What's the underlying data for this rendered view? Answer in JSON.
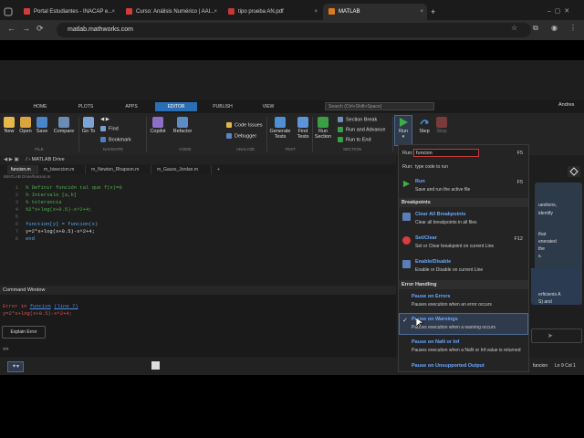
{
  "browser": {
    "tabs": [
      {
        "label": "Portal Estudiantes - INACAP e...",
        "color": "#d43c3c"
      },
      {
        "label": "Curso: Análisis Numérico | AAI...",
        "color": "#d43c3c"
      },
      {
        "label": "tipo prueba AN.pdf",
        "color": "#c93636"
      },
      {
        "label": "MATLAB",
        "color": "#e07a1f"
      }
    ],
    "new_tab": "+",
    "url": "matlab.mathworks.com"
  },
  "matlab": {
    "ribbon_tabs": [
      "HOME",
      "PLOTS",
      "APPS",
      "EDITOR",
      "PUBLISH",
      "VIEW"
    ],
    "active_ribbon_tab": "EDITOR",
    "search_placeholder": "Search (Ctrl+Shift+Space)",
    "user": "Andres",
    "toolstrip": {
      "new": "New",
      "open": "Open",
      "save": "Save",
      "compare": "Compare",
      "file_group": "FILE",
      "goto": "Go To",
      "find": "Find",
      "bookmark": "Bookmark",
      "navigate_group": "NAVIGATE",
      "copilot": "Copilot",
      "refactor": "Refactor",
      "code_issues": "Code Issues",
      "debugger": "Debugger",
      "code_group": "CODE",
      "analyze_group": "ANALYZE",
      "generate_tests": [
        "Generate",
        "Tests"
      ],
      "find_tests": [
        "Find",
        "Tests"
      ],
      "test_group": "TEST",
      "section_break": "Section Break",
      "run_and_advance": "Run and Advance",
      "run_to_end": "Run to End",
      "run_section": [
        "Run",
        "Section"
      ],
      "section_group": "SECTION",
      "run": "Run",
      "step": "Step",
      "stop": "Stop"
    },
    "path": "/  ›  MATLAB Drive",
    "editor_tabs": [
      "funcion.m",
      "m_biseccion.m",
      "m_Newton_Rhapson.m",
      "m_Gauss_Jordan.m"
    ],
    "editor_file_path": "/MATLAB Drive/funcion.m",
    "code_lines": [
      {
        "n": "1",
        "text": "% Definir función tal que f(x)=0",
        "cls": "cm"
      },
      {
        "n": "2",
        "text": "% Intervalo [a,b]",
        "cls": "cm"
      },
      {
        "n": "3",
        "text": "% tolerancia",
        "cls": "cm"
      },
      {
        "n": "4",
        "text": "%2*x+log(x+0.5)-x^2+4;",
        "cls": "cm"
      },
      {
        "n": "5",
        "text": "",
        "cls": "tx"
      },
      {
        "n": "6",
        "text": "function[y] = funcion(x)",
        "cls": "kw"
      },
      {
        "n": "7",
        "text": "y=2*x+log(x+0.5)-x^2+4;",
        "cls": "tx"
      },
      {
        "n": "8",
        "text": "end",
        "cls": "kw"
      }
    ],
    "command_window": {
      "title": "Command Window",
      "error_prefix": "Error in ",
      "error_func": "funcion",
      "error_line": "(line 7)",
      "error_code": "y=2*x+log(x+0.5)-x^2+4;",
      "explain": "Explain Error",
      "prompt": ">>"
    },
    "status": {
      "func": "funcion",
      "pos": "Ln  9  Col  1"
    },
    "right_panel": {
      "texts": [
        "uestions,",
        "identify",
        "that",
        "enerated",
        "the",
        "s.",
        "erficients A",
        "S) and"
      ]
    },
    "run_menu": {
      "run_label": "Run:",
      "run_value": "funcion",
      "run_key": "F5",
      "run_hint": "type code to run",
      "items_top": [
        {
          "title": "Run",
          "desc": "Save and run the active file",
          "key": "F5",
          "icon_color": "#3cb043"
        }
      ],
      "breakpoints_header": "Breakpoints",
      "breakpoints": [
        {
          "title": "Clear All Breakpoints",
          "desc": "Clear all breakpoints in all files",
          "key": "",
          "icon_color": "#5a7fb8"
        },
        {
          "title": "Set/Clear",
          "desc": "Set or Clear breakpoint on current Line",
          "key": "F12",
          "icon_color": "#d93c3c"
        },
        {
          "title": "Enable/Disable",
          "desc": "Enable or Disable on current Line",
          "key": "",
          "icon_color": "#5a7fb8"
        }
      ],
      "error_header": "Error Handling",
      "errors": [
        {
          "title": "Pause on Errors",
          "desc": "Pauses execution when an error occurs",
          "checked": ""
        },
        {
          "title": "Pause on Warnings",
          "desc": "Pauses execution when a warning occurs",
          "checked": "✓"
        },
        {
          "title": "Pause on NaN or Inf",
          "desc": "Pauses execution when a NaN or Inf value is returned",
          "checked": ""
        },
        {
          "title": "Pause on Unsupported Output",
          "desc": "",
          "checked": ""
        }
      ]
    }
  }
}
